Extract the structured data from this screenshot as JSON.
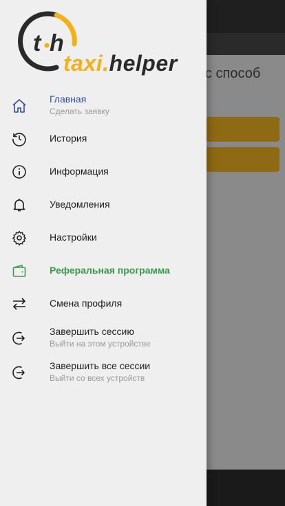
{
  "background": {
    "text": "с способ"
  },
  "logo": {
    "mark_text": "t·h",
    "brand_part1": "taxi.",
    "brand_part2": "helper",
    "colors": {
      "accent": "#f4b016",
      "dark": "#2a2a2a"
    }
  },
  "menu": {
    "items": [
      {
        "label": "Главная",
        "sub": "Сделать заявку",
        "icon": "home-icon"
      },
      {
        "label": "История",
        "icon": "history-icon"
      },
      {
        "label": "Информация",
        "icon": "info-icon"
      },
      {
        "label": "Уведомления",
        "icon": "bell-icon"
      },
      {
        "label": "Настройки",
        "icon": "gear-icon"
      },
      {
        "label": "Реферальная программа",
        "icon": "wallet-icon"
      },
      {
        "label": "Смена профиля",
        "icon": "swap-icon"
      },
      {
        "label": "Завершить сессию",
        "sub": "Выйти на этом устройстве",
        "icon": "logout-icon"
      },
      {
        "label": "Завершить все сессии",
        "sub": "Выйти со всех устройств",
        "icon": "logout-all-icon"
      }
    ]
  },
  "colors": {
    "active": "#2f4ea0",
    "referral": "#3c9a4b",
    "accent_button": "#8f6a14"
  }
}
